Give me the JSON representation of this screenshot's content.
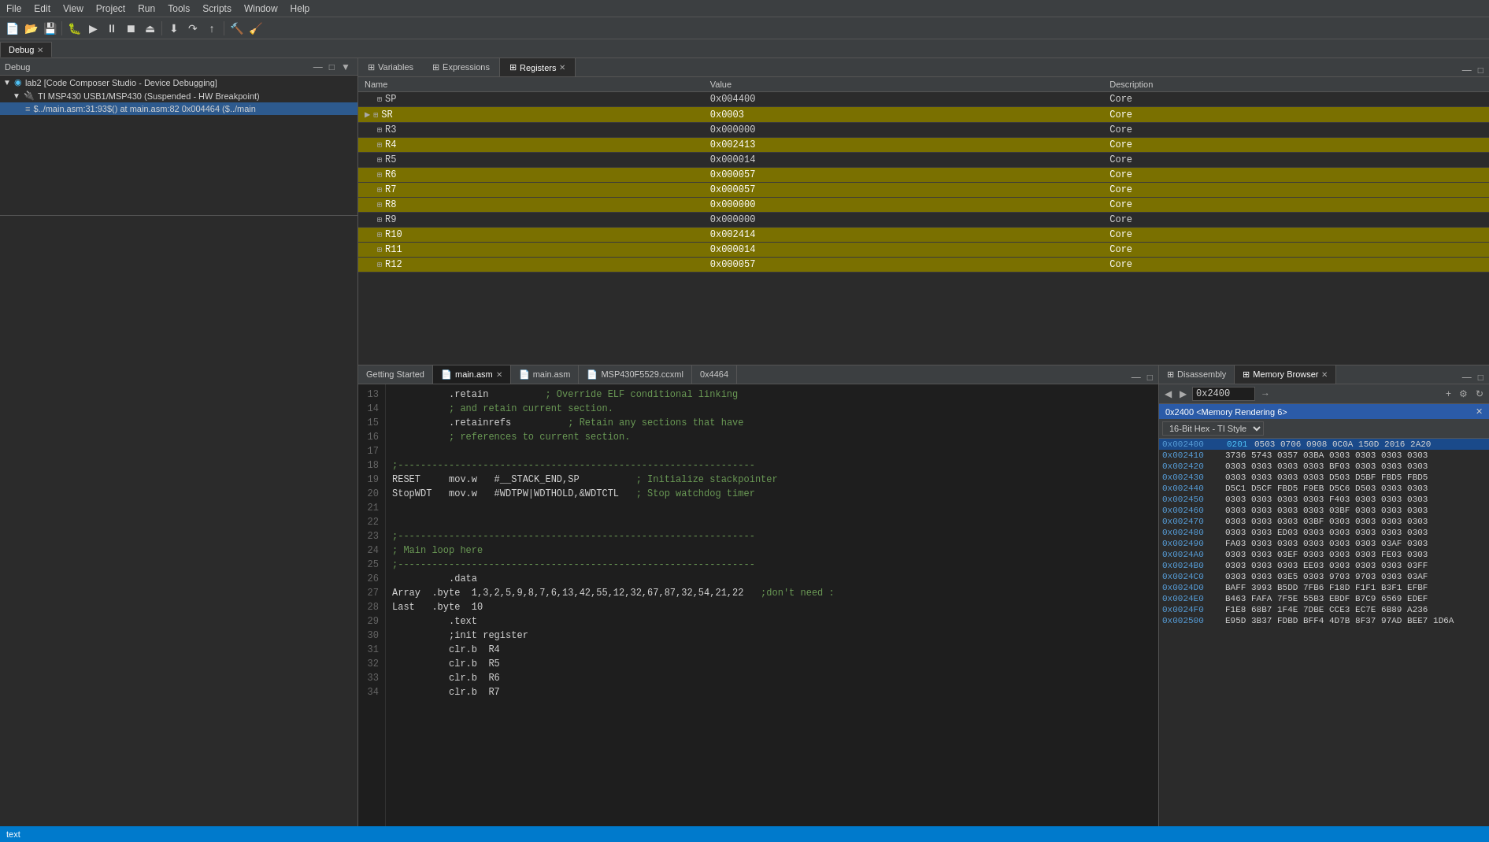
{
  "menubar": {
    "items": [
      "File",
      "Edit",
      "View",
      "Project",
      "Run",
      "Tools",
      "Scripts",
      "Window",
      "Help"
    ]
  },
  "debug_panel": {
    "title": "Debug",
    "tree": {
      "root": "lab2 [Code Composer Studio - Device Debugging]",
      "child1": "TI MSP430 USB1/MSP430 (Suspended - HW Breakpoint)",
      "child2": "$../main.asm:31:93$() at main.asm:82 0x004464  ($../main"
    }
  },
  "registers": {
    "tab_variables": "Variables",
    "tab_expressions": "Expressions",
    "tab_registers": "Registers",
    "columns": [
      "Name",
      "Value",
      "Description"
    ],
    "rows": [
      {
        "name": "SP",
        "value": "0x004400",
        "desc": "Core",
        "highlighted": false
      },
      {
        "name": "SR",
        "value": "0x0003",
        "desc": "Core",
        "highlighted": true,
        "expandable": true
      },
      {
        "name": "R3",
        "value": "0x000000",
        "desc": "Core",
        "highlighted": false
      },
      {
        "name": "R4",
        "value": "0x002413",
        "desc": "Core",
        "highlighted": true
      },
      {
        "name": "R5",
        "value": "0x000014",
        "desc": "Core",
        "highlighted": false
      },
      {
        "name": "R6",
        "value": "0x000057",
        "desc": "Core",
        "highlighted": true
      },
      {
        "name": "R7",
        "value": "0x000057",
        "desc": "Core",
        "highlighted": true
      },
      {
        "name": "R8",
        "value": "0x000000",
        "desc": "Core",
        "highlighted": true
      },
      {
        "name": "R9",
        "value": "0x000000",
        "desc": "Core",
        "highlighted": false
      },
      {
        "name": "R10",
        "value": "0x002414",
        "desc": "Core",
        "highlighted": true
      },
      {
        "name": "R11",
        "value": "0x000014",
        "desc": "Core",
        "highlighted": true
      },
      {
        "name": "R12",
        "value": "0x000057",
        "desc": "Core",
        "highlighted": true
      }
    ]
  },
  "code_editor": {
    "tabs": [
      {
        "label": "Getting Started",
        "active": false
      },
      {
        "label": "main.asm",
        "active": true,
        "closeable": true
      },
      {
        "label": "main.asm",
        "active": false,
        "closeable": false
      },
      {
        "label": "MSP430F5529.ccxml",
        "active": false
      },
      {
        "label": "0x4464",
        "active": false
      }
    ],
    "lines": [
      {
        "num": "13",
        "text": "          .retain",
        "comment": "          ; Override ELF conditional linking"
      },
      {
        "num": "14",
        "text": "",
        "comment": "          ; and retain current section."
      },
      {
        "num": "15",
        "text": "          .retainrefs",
        "comment": "          ; Retain any sections that have"
      },
      {
        "num": "16",
        "text": "",
        "comment": "          ; references to current section."
      },
      {
        "num": "17",
        "text": ""
      },
      {
        "num": "18",
        "text": ";---------------------------------------------------------------"
      },
      {
        "num": "19",
        "text": "RESET     mov.w   #__STACK_END,SP",
        "comment": "          ; Initialize stackpointer"
      },
      {
        "num": "20",
        "text": "StopWDT   mov.w   #WDTPW|WDTHOLD,&WDTCTL",
        "comment": "   ; Stop watchdog timer"
      },
      {
        "num": "21",
        "text": ""
      },
      {
        "num": "22",
        "text": ""
      },
      {
        "num": "23",
        "text": ";---------------------------------------------------------------"
      },
      {
        "num": "24",
        "text": "; Main loop here"
      },
      {
        "num": "25",
        "text": ";---------------------------------------------------------------"
      },
      {
        "num": "26",
        "text": "          .data"
      },
      {
        "num": "27",
        "text": "Array  .byte  1,3,2,5,9,8,7,6,13,42,55,12,32,67,87,32,54,21,22",
        "comment": "   ;don't need :"
      },
      {
        "num": "28",
        "text": "Last   .byte  10"
      },
      {
        "num": "29",
        "text": "          .text"
      },
      {
        "num": "30",
        "text": "          ;init register"
      },
      {
        "num": "31",
        "text": "          clr.b  R4"
      },
      {
        "num": "32",
        "text": "          clr.b  R5"
      },
      {
        "num": "33",
        "text": "          clr.b  R6"
      },
      {
        "num": "34",
        "text": "          clr.b  R7"
      }
    ]
  },
  "disassembly": {
    "tab_label": "Disassembly",
    "tab_memory": "Memory Browser",
    "addr_input": "0x2400",
    "rendering_title": "0x2400 <Memory Rendering 6>",
    "format_label": "16-Bit Hex - TI Style",
    "rows": [
      {
        "addr": "0x002400",
        "data": "0201 0503 0706 0908 0C0A 150D 2016 2A20",
        "selected": true
      },
      {
        "addr": "0x002410",
        "data": "3736 5743 0357 03BA 0303 0303 0303 0303"
      },
      {
        "addr": "0x002420",
        "data": "0303 0303 0303 0303 BF03 0303 0303 0303"
      },
      {
        "addr": "0x002430",
        "data": "0303 0303 0303 0303 D503 D5BF FBD5 FBD5"
      },
      {
        "addr": "0x002440",
        "data": "D5C1 D5CF FBD5 F9EB D5C6 D503 0303 0303"
      },
      {
        "addr": "0x002450",
        "data": "0303 0303 0303 0303 F403 0303 0303 0303"
      },
      {
        "addr": "0x002460",
        "data": "0303 0303 0303 0303 03BF 0303 0303 0303"
      },
      {
        "addr": "0x002470",
        "data": "0303 0303 0303 03BF 0303 0303 0303 0303"
      },
      {
        "addr": "0x002480",
        "data": "0303 0303 ED03 0303 0303 0303 0303 0303"
      },
      {
        "addr": "0x002490",
        "data": "FA03 0303 0303 0303 0303 0303 03AF 0303"
      },
      {
        "addr": "0x0024A0",
        "data": "0303 0303 03EF 0303 0303 0303 FE03 0303"
      },
      {
        "addr": "0x0024B0",
        "data": "0303 0303 0303 EE03 0303 0303 0303 03FF"
      },
      {
        "addr": "0x0024C0",
        "data": "0303 0303 03E5 0303 9703 9703 0303 03AF"
      },
      {
        "addr": "0x0024D0",
        "data": "BAFF 3993 B5DD 7FB6 F18D F1F1 B3F1 EFBF"
      },
      {
        "addr": "0x0024E0",
        "data": "B463 FAFA 7F5E 55B3 EBDF B7C9 6569 EDEF"
      },
      {
        "addr": "0x0024F0",
        "data": "F1E8 68B7 1F4E 7DBE CCE3 EC7E 6B89 A236"
      },
      {
        "addr": "0x002500",
        "data": "E95D 3B37 FDBD BFF4 4D7B 8F37 97AD BEE7 1D6A"
      }
    ]
  },
  "status_bar": {
    "text_label": "text"
  }
}
